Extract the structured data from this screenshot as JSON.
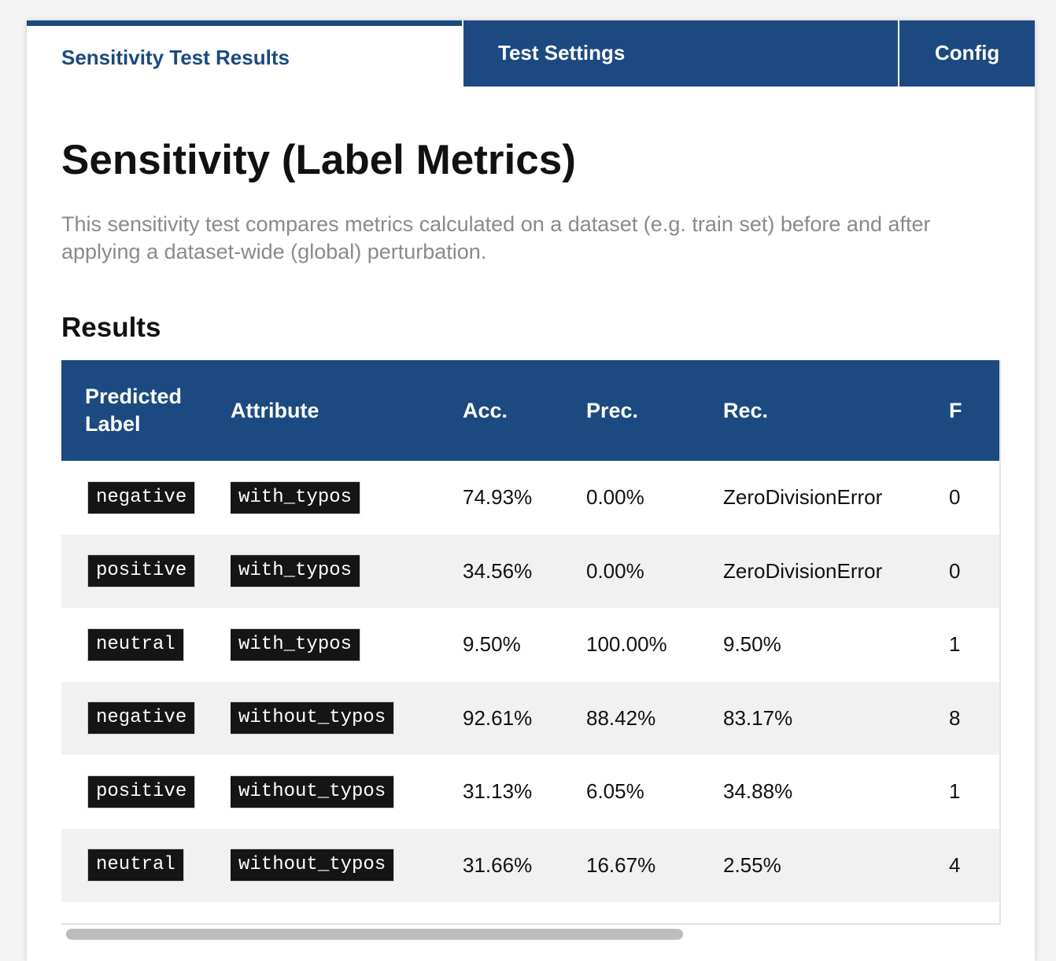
{
  "tabs": [
    {
      "label": "Sensitivity Test Results",
      "active": true
    },
    {
      "label": "Test Settings",
      "active": false
    },
    {
      "label": "Config",
      "active": false
    }
  ],
  "page": {
    "title": "Sensitivity (Label Metrics)",
    "description": "This sensitivity test compares metrics calculated on a dataset (e.g. train set) before and after applying a dataset-wide (global) perturbation.",
    "results_heading": "Results"
  },
  "table": {
    "columns": [
      "Predicted Label",
      "Attribute",
      "Acc.",
      "Prec.",
      "Rec.",
      "F"
    ],
    "rows": [
      {
        "label": "negative",
        "attribute": "with_typos",
        "acc": "74.93%",
        "prec": "0.00%",
        "rec": "ZeroDivisionError",
        "f": "0"
      },
      {
        "label": "positive",
        "attribute": "with_typos",
        "acc": "34.56%",
        "prec": "0.00%",
        "rec": "ZeroDivisionError",
        "f": "0"
      },
      {
        "label": "neutral",
        "attribute": "with_typos",
        "acc": "9.50%",
        "prec": "100.00%",
        "rec": "9.50%",
        "f": "1"
      },
      {
        "label": "negative",
        "attribute": "without_typos",
        "acc": "92.61%",
        "prec": "88.42%",
        "rec": "83.17%",
        "f": "8"
      },
      {
        "label": "positive",
        "attribute": "without_typos",
        "acc": "31.13%",
        "prec": "6.05%",
        "rec": "34.88%",
        "f": "1"
      },
      {
        "label": "neutral",
        "attribute": "without_typos",
        "acc": "31.66%",
        "prec": "16.67%",
        "rec": "2.55%",
        "f": "4"
      }
    ]
  },
  "colors": {
    "accent": "#1c4a80",
    "code_bg": "#151515",
    "stripe": "#f1f1f1",
    "muted_text": "#8a8a8a"
  }
}
